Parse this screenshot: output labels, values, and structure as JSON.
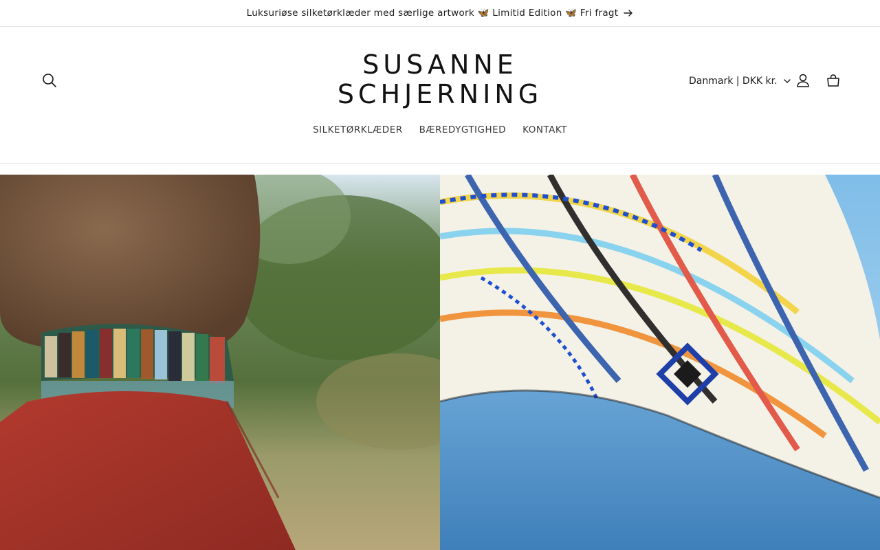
{
  "announcement": {
    "text": "Luksuriøse silketørklæder med særlige artwork 🦋 Limitid Edition  🦋 Fri fragt"
  },
  "header": {
    "logo_line1": "SUSANNE",
    "logo_line2": "SCHJERNING",
    "locale": "Danmark | DKK kr."
  },
  "nav": {
    "items": [
      {
        "label": "SILKETØRKLÆDER"
      },
      {
        "label": "BÆREDYGTIGHED"
      },
      {
        "label": "KONTAKT"
      }
    ]
  },
  "icons": {
    "search": "search-icon",
    "account": "user-icon",
    "cart": "cart-icon",
    "locale_chevron": "chevron-down-icon",
    "announcement_arrow": "arrow-right-icon"
  },
  "colors": {
    "text": "#121212",
    "border": "#e6e6e6",
    "coat": "#a8352b",
    "sky": "#9fd0f0",
    "sea": "#4d8fc8"
  },
  "hero": {
    "left_image": "woman-wearing-silk-scarf-photo",
    "right_image": "silk-scarf-flying-over-sea-photo"
  }
}
